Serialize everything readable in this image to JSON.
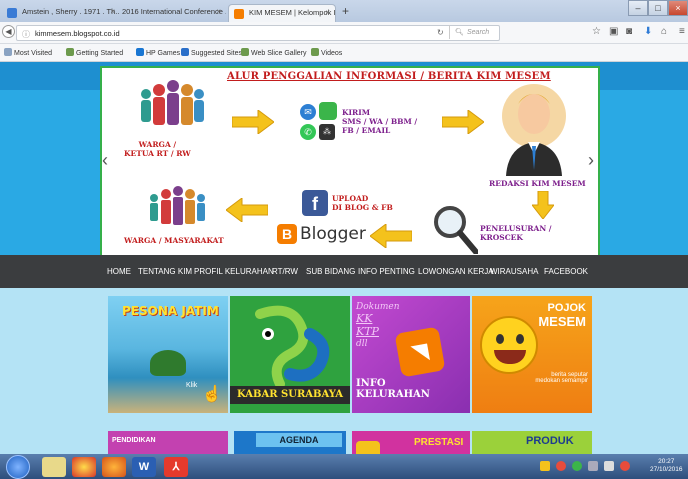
{
  "browser": {
    "tabs": [
      {
        "title": "Amstein , Sherry . 1971 . Th...",
        "active": false
      },
      {
        "title": "2016 International Conference ...",
        "active": false
      },
      {
        "title": "KIM MESEM | Kelompok In...",
        "active": true
      }
    ],
    "new_tab": "+",
    "url": "kimmesem.blogspot.co.id",
    "search_placeholder": "Search",
    "bookmarks": [
      "Most Visited",
      "Getting Started",
      "HP Games",
      "Suggested Sites",
      "Web Slice Gallery",
      "Videos"
    ]
  },
  "banner": {
    "title": "ALUR PENGGALIAN INFORMASI / BERITA KIM MESEM",
    "warga_ketua": "WARGA /\nKETUA RT / RW",
    "kirim": "KIRIM\nSMS / WA / BBM /\nFB / EMAIL",
    "redaksi": "REDAKSI KIM MESEM",
    "upload": "UPLOAD\nDI BLOG & FB",
    "blogger": "Blogger",
    "warga_masyarakat": "WARGA / MASYARAKAT",
    "penelusuran": "PENELUSURAN /\nKROSCEK",
    "prev": "‹",
    "next": "›"
  },
  "menu": [
    "HOME",
    "TENTANG KIM",
    "PROFIL KELURAHAN",
    "RT/RW",
    "SUB BIDANG",
    "INFO PENTING",
    "LOWONGAN KERJA",
    "WIRAUSAHA",
    "FACEBOOK"
  ],
  "gallery": {
    "pesona": "PESONA JATIM",
    "klik": "Klik",
    "kabar": "KABAR SURABAYA",
    "dokumen": "Dokumen",
    "kk": "KK",
    "ktp": "KTP",
    "dll": "dll",
    "info": "INFO",
    "kelurahan": "KELURAHAN",
    "pojok": "POJOK",
    "mesem": "MESEM",
    "berita": "berita seputar\nmedokan semampir",
    "pendidikan": "PENDIDIKAN",
    "agenda": "AGENDA",
    "prestasi": "PRESTASI",
    "produk": "PRODUK"
  },
  "taskbar": {
    "time": "20:27",
    "date": "27/10/2016"
  },
  "colors": {
    "menu_bg": "#3b3d3f",
    "page_blue": "#2aa9e4",
    "banner_border": "#35b04a",
    "banner_red": "#c21d1d"
  }
}
